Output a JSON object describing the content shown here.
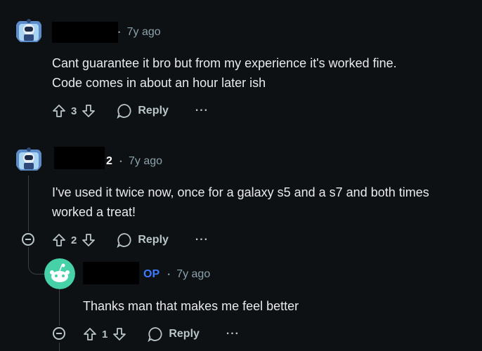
{
  "comments": [
    {
      "time": "7y ago",
      "username_suffix": "",
      "op_badge": "",
      "body": [
        "Cant guarantee it bro but from my experience it's worked fine.",
        "Code comes in about an hour later ish"
      ],
      "score": "3",
      "reply_label": "Reply",
      "more_label": "···"
    },
    {
      "time": "7y ago",
      "username_suffix": "2",
      "op_badge": "",
      "body": [
        "I've used it twice now, once for a galaxy s5 and a s7 and both times",
        "worked a treat!"
      ],
      "score": "2",
      "reply_label": "Reply",
      "more_label": "···"
    },
    {
      "time": "7y ago",
      "username_suffix": "",
      "op_badge": "OP",
      "body": [
        "Thanks man that makes me feel better"
      ],
      "score": "1",
      "reply_label": "Reply",
      "more_label": "···"
    }
  ],
  "separator": "•",
  "colors": {
    "background": "#0e1113",
    "op": "#3d7bff",
    "muted": "#8ba2ad",
    "avatar_teal": "#46d1a8"
  }
}
